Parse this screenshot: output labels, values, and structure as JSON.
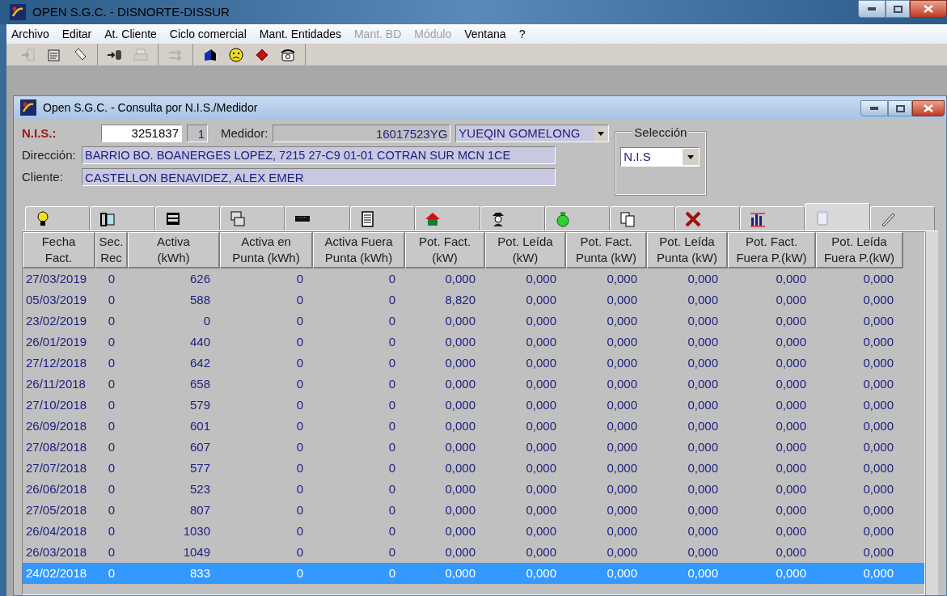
{
  "window": {
    "title": "OPEN S.G.C. -  DISNORTE-DISSUR"
  },
  "menu": [
    {
      "label": "Archivo",
      "disabled": false
    },
    {
      "label": "Editar",
      "disabled": false
    },
    {
      "label": "At. Cliente",
      "disabled": false
    },
    {
      "label": "Ciclo comercial",
      "disabled": false
    },
    {
      "label": "Mant. Entidades",
      "disabled": false
    },
    {
      "label": "Mant. BD",
      "disabled": true
    },
    {
      "label": "Módulo",
      "disabled": true
    },
    {
      "label": "Ventana",
      "disabled": false
    },
    {
      "label": "?",
      "disabled": false
    }
  ],
  "toolbar_groups": [
    {
      "items": [
        {
          "kind": "exit",
          "disabled": true
        },
        {
          "kind": "notepad",
          "disabled": false
        },
        {
          "kind": "eraser",
          "disabled": false
        }
      ]
    },
    {
      "items": [
        {
          "kind": "arrow-cylinder",
          "disabled": false
        },
        {
          "kind": "printer",
          "disabled": true
        }
      ]
    },
    {
      "items": [
        {
          "kind": "arrows",
          "disabled": true
        }
      ]
    },
    {
      "items": [
        {
          "kind": "book",
          "disabled": false
        },
        {
          "kind": "smiley",
          "disabled": false
        },
        {
          "kind": "gem",
          "disabled": false
        },
        {
          "kind": "phone",
          "disabled": false
        }
      ]
    }
  ],
  "child_window": {
    "title": "Open S.G.C. - Consulta por N.I.S./Medidor"
  },
  "form": {
    "nis_label": "N.I.S.:",
    "nis": "3251837",
    "nis_suffix": "1",
    "medidor_label": "Medidor:",
    "medidor": "16017523YG",
    "medidor_owner": "YUEQIN GOMELONG",
    "direccion_label": "Dirección:",
    "direccion": "BARRIO BO. BOANERGES LOPEZ, 7215 27-C9 01-01 COTRAN SUR MCN 1CE",
    "cliente_label": "Cliente:",
    "cliente": "CASTELLON BENAVIDEZ, ALEX EMER"
  },
  "seleccion": {
    "title": "Selección",
    "value": "N.I.S"
  },
  "tabs": [
    {
      "kind": "bulb",
      "selected": false
    },
    {
      "kind": "binder",
      "selected": false
    },
    {
      "kind": "terminal",
      "selected": false
    },
    {
      "kind": "screens",
      "selected": false
    },
    {
      "kind": "bar",
      "selected": false
    },
    {
      "kind": "document",
      "selected": false
    },
    {
      "kind": "house",
      "selected": false
    },
    {
      "kind": "figure",
      "selected": false
    },
    {
      "kind": "moneybag",
      "selected": false
    },
    {
      "kind": "copies",
      "selected": false
    },
    {
      "kind": "cross",
      "selected": false
    },
    {
      "kind": "chart",
      "selected": false
    },
    {
      "kind": "clipboard",
      "selected": true
    },
    {
      "kind": "pen",
      "selected": false
    }
  ],
  "table": {
    "columns": [
      {
        "lines": [
          "Fecha",
          "Fact."
        ]
      },
      {
        "lines": [
          "Sec.",
          "Rec"
        ]
      },
      {
        "lines": [
          "Activa",
          "(kWh)"
        ]
      },
      {
        "lines": [
          "Activa en",
          "Punta (kWh)"
        ]
      },
      {
        "lines": [
          "Activa Fuera",
          "Punta (kWh)"
        ]
      },
      {
        "lines": [
          "Pot. Fact.",
          "(kW)"
        ]
      },
      {
        "lines": [
          "Pot. Leída",
          "(kW)"
        ]
      },
      {
        "lines": [
          "Pot. Fact.",
          "Punta (kW)"
        ]
      },
      {
        "lines": [
          "Pot. Leída",
          "Punta (kW)"
        ]
      },
      {
        "lines": [
          "Pot. Fact.",
          "Fuera P.(kW)"
        ]
      },
      {
        "lines": [
          "Pot. Leída",
          "Fuera P.(kW)"
        ]
      }
    ],
    "rows": [
      {
        "cells": [
          "27/03/2019",
          "0",
          "626",
          "0",
          "0",
          "0,000",
          "0,000",
          "0,000",
          "0,000",
          "0,000",
          "0,000"
        ],
        "selected": false
      },
      {
        "cells": [
          "05/03/2019",
          "0",
          "588",
          "0",
          "0",
          "8,820",
          "0,000",
          "0,000",
          "0,000",
          "0,000",
          "0,000"
        ],
        "selected": false
      },
      {
        "cells": [
          "23/02/2019",
          "0",
          "0",
          "0",
          "0",
          "0,000",
          "0,000",
          "0,000",
          "0,000",
          "0,000",
          "0,000"
        ],
        "selected": false
      },
      {
        "cells": [
          "26/01/2019",
          "0",
          "440",
          "0",
          "0",
          "0,000",
          "0,000",
          "0,000",
          "0,000",
          "0,000",
          "0,000"
        ],
        "selected": false
      },
      {
        "cells": [
          "27/12/2018",
          "0",
          "642",
          "0",
          "0",
          "0,000",
          "0,000",
          "0,000",
          "0,000",
          "0,000",
          "0,000"
        ],
        "selected": false
      },
      {
        "cells": [
          "26/11/2018",
          "0",
          "658",
          "0",
          "0",
          "0,000",
          "0,000",
          "0,000",
          "0,000",
          "0,000",
          "0,000"
        ],
        "selected": false
      },
      {
        "cells": [
          "27/10/2018",
          "0",
          "579",
          "0",
          "0",
          "0,000",
          "0,000",
          "0,000",
          "0,000",
          "0,000",
          "0,000"
        ],
        "selected": false
      },
      {
        "cells": [
          "26/09/2018",
          "0",
          "601",
          "0",
          "0",
          "0,000",
          "0,000",
          "0,000",
          "0,000",
          "0,000",
          "0,000"
        ],
        "selected": false
      },
      {
        "cells": [
          "27/08/2018",
          "0",
          "607",
          "0",
          "0",
          "0,000",
          "0,000",
          "0,000",
          "0,000",
          "0,000",
          "0,000"
        ],
        "selected": false
      },
      {
        "cells": [
          "27/07/2018",
          "0",
          "577",
          "0",
          "0",
          "0,000",
          "0,000",
          "0,000",
          "0,000",
          "0,000",
          "0,000"
        ],
        "selected": false
      },
      {
        "cells": [
          "26/06/2018",
          "0",
          "523",
          "0",
          "0",
          "0,000",
          "0,000",
          "0,000",
          "0,000",
          "0,000",
          "0,000"
        ],
        "selected": false
      },
      {
        "cells": [
          "27/05/2018",
          "0",
          "807",
          "0",
          "0",
          "0,000",
          "0,000",
          "0,000",
          "0,000",
          "0,000",
          "0,000"
        ],
        "selected": false
      },
      {
        "cells": [
          "26/04/2018",
          "0",
          "1030",
          "0",
          "0",
          "0,000",
          "0,000",
          "0,000",
          "0,000",
          "0,000",
          "0,000"
        ],
        "selected": false
      },
      {
        "cells": [
          "26/03/2018",
          "0",
          "1049",
          "0",
          "0",
          "0,000",
          "0,000",
          "0,000",
          "0,000",
          "0,000",
          "0,000"
        ],
        "selected": false
      },
      {
        "cells": [
          "24/02/2018",
          "0",
          "833",
          "0",
          "0",
          "0,000",
          "0,000",
          "0,000",
          "0,000",
          "0,000",
          "0,000"
        ],
        "selected": true
      }
    ]
  }
}
